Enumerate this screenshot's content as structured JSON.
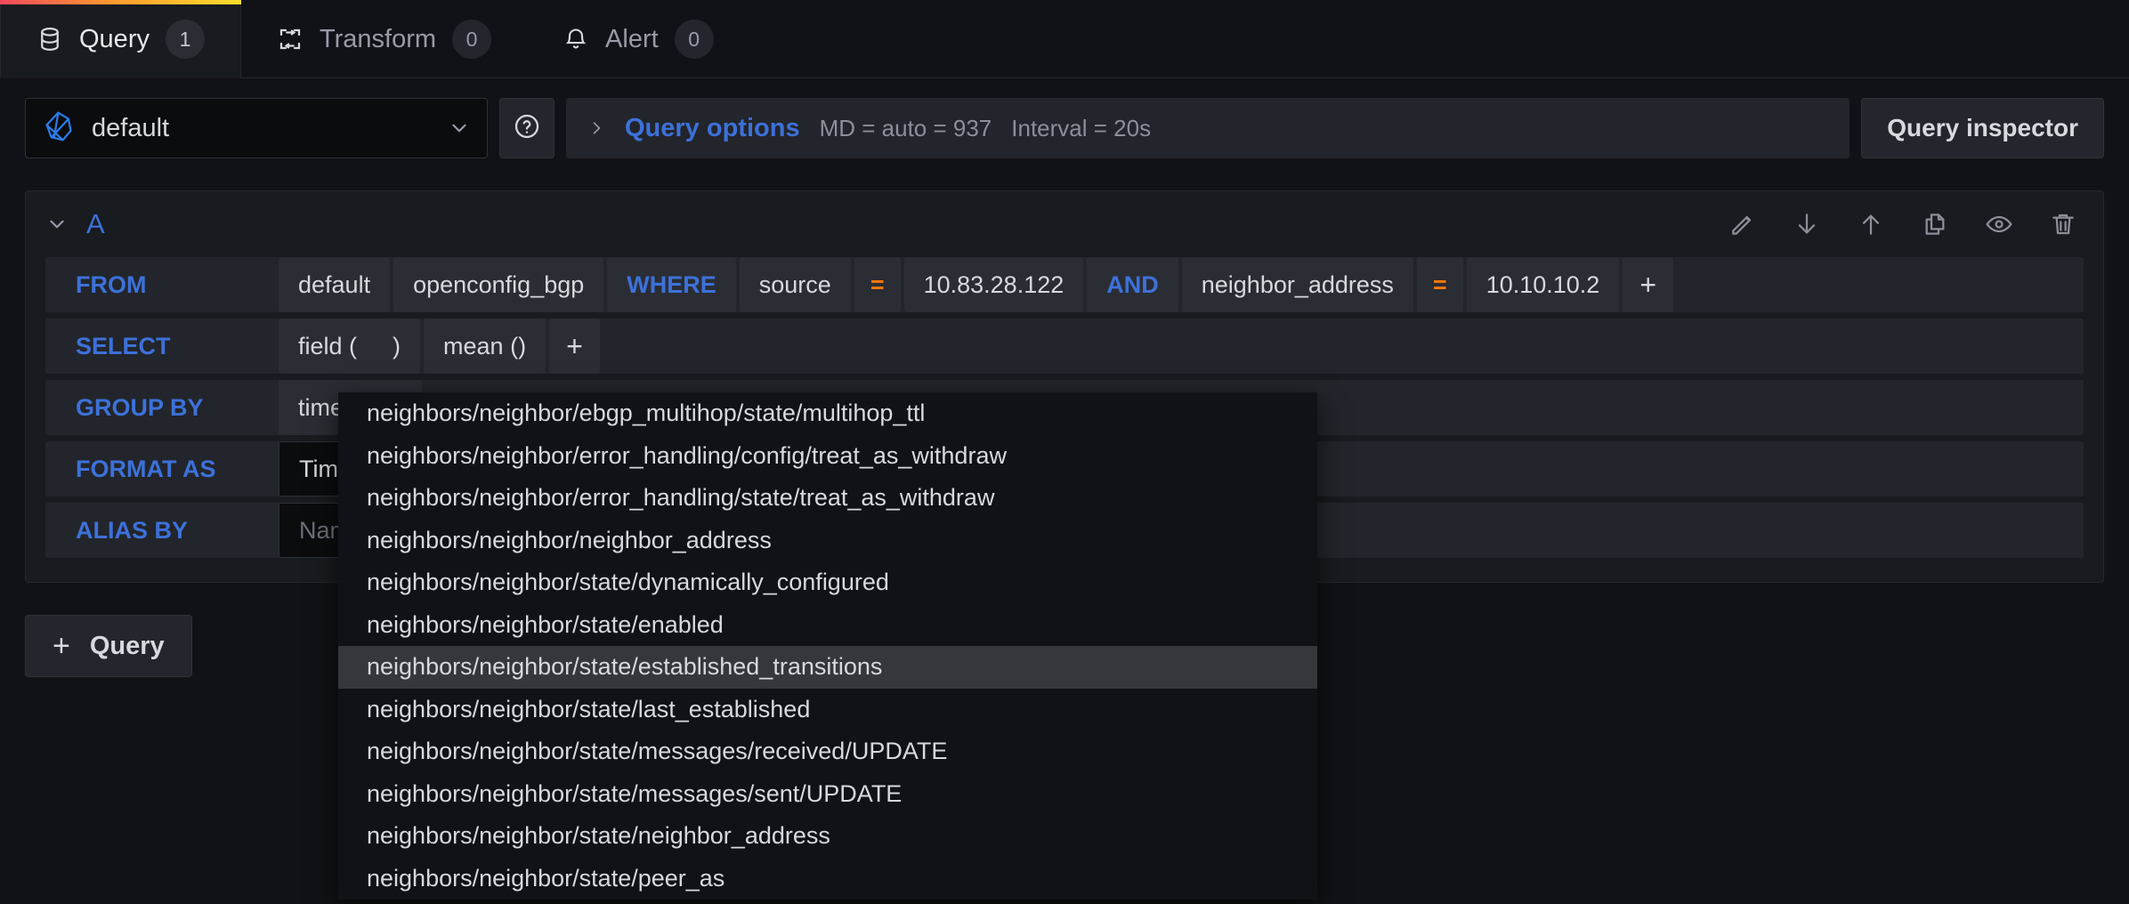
{
  "tabs": [
    {
      "label": "Query",
      "count": "1",
      "icon": "database-icon",
      "active": true
    },
    {
      "label": "Transform",
      "count": "0",
      "icon": "transform-icon",
      "active": false
    },
    {
      "label": "Alert",
      "count": "0",
      "icon": "bell-icon",
      "active": false
    }
  ],
  "datasource": {
    "name": "default",
    "icon": "influxdb-icon",
    "chevron": "chevron-down-icon",
    "help_icon": "question-circle-icon"
  },
  "query_options": {
    "caret": "chevron-right-icon",
    "title": "Query options",
    "max_data_points": "MD = auto = 937",
    "interval": "Interval = 20s"
  },
  "query_inspector": {
    "label": "Query inspector"
  },
  "query_a": {
    "collapse_icon": "chevron-down-icon",
    "letter": "A",
    "actions": [
      {
        "name": "edit-query-icon"
      },
      {
        "name": "move-query-down-icon"
      },
      {
        "name": "move-query-up-icon"
      },
      {
        "name": "duplicate-query-icon"
      },
      {
        "name": "toggle-visibility-icon"
      },
      {
        "name": "delete-query-icon"
      }
    ],
    "rows": [
      {
        "label": "FROM",
        "items": [
          {
            "text": "default",
            "kind": "value"
          },
          {
            "text": "openconfig_bgp",
            "kind": "value"
          },
          {
            "text": "WHERE",
            "kind": "keyword"
          },
          {
            "text": "source",
            "kind": "value"
          },
          {
            "text": "=",
            "kind": "operator"
          },
          {
            "text": "10.83.28.122",
            "kind": "value"
          },
          {
            "text": "AND",
            "kind": "keyword"
          },
          {
            "text": "neighbor_address",
            "kind": "value"
          },
          {
            "text": "=",
            "kind": "operator"
          },
          {
            "text": "10.10.10.2",
            "kind": "value"
          },
          {
            "text": "+",
            "kind": "plus"
          }
        ]
      },
      {
        "label": "SELECT",
        "items": [
          {
            "text": "field (",
            "text2": ")",
            "kind": "editing"
          },
          {
            "text": "mean ()",
            "kind": "value"
          },
          {
            "text": "+",
            "kind": "plus"
          }
        ]
      },
      {
        "label": "GROUP BY",
        "items": [
          {
            "text": "time (",
            "text2": ")",
            "kind": "editing"
          }
        ]
      },
      {
        "label": "FORMAT AS",
        "items": [
          {
            "text": "Time series",
            "kind": "input"
          }
        ]
      },
      {
        "label": "ALIAS BY",
        "items": [
          {
            "text": "Naming pattern",
            "kind": "placeholder"
          }
        ]
      }
    ]
  },
  "add_query": {
    "plus": "+",
    "label": "Query"
  },
  "field_dropdown": {
    "selected": "neighbors/neighbor/state/established_transitions",
    "options": [
      "neighbors/neighbor/ebgp_multihop/state/multihop_ttl",
      "neighbors/neighbor/error_handling/config/treat_as_withdraw",
      "neighbors/neighbor/error_handling/state/treat_as_withdraw",
      "neighbors/neighbor/neighbor_address",
      "neighbors/neighbor/state/dynamically_configured",
      "neighbors/neighbor/state/enabled",
      "neighbors/neighbor/state/established_transitions",
      "neighbors/neighbor/state/last_established",
      "neighbors/neighbor/state/messages/received/UPDATE",
      "neighbors/neighbor/state/messages/sent/UPDATE",
      "neighbors/neighbor/state/neighbor_address",
      "neighbors/neighbor/state/peer_as"
    ]
  },
  "colors": {
    "accent_blue": "#3d71d9",
    "operator_orange": "#ff780a",
    "panel_bg": "#181b1f",
    "page_bg": "#111217",
    "segment_bg": "#2a2d34",
    "row_bg": "#22252b",
    "selected_bg": "#35373d"
  }
}
